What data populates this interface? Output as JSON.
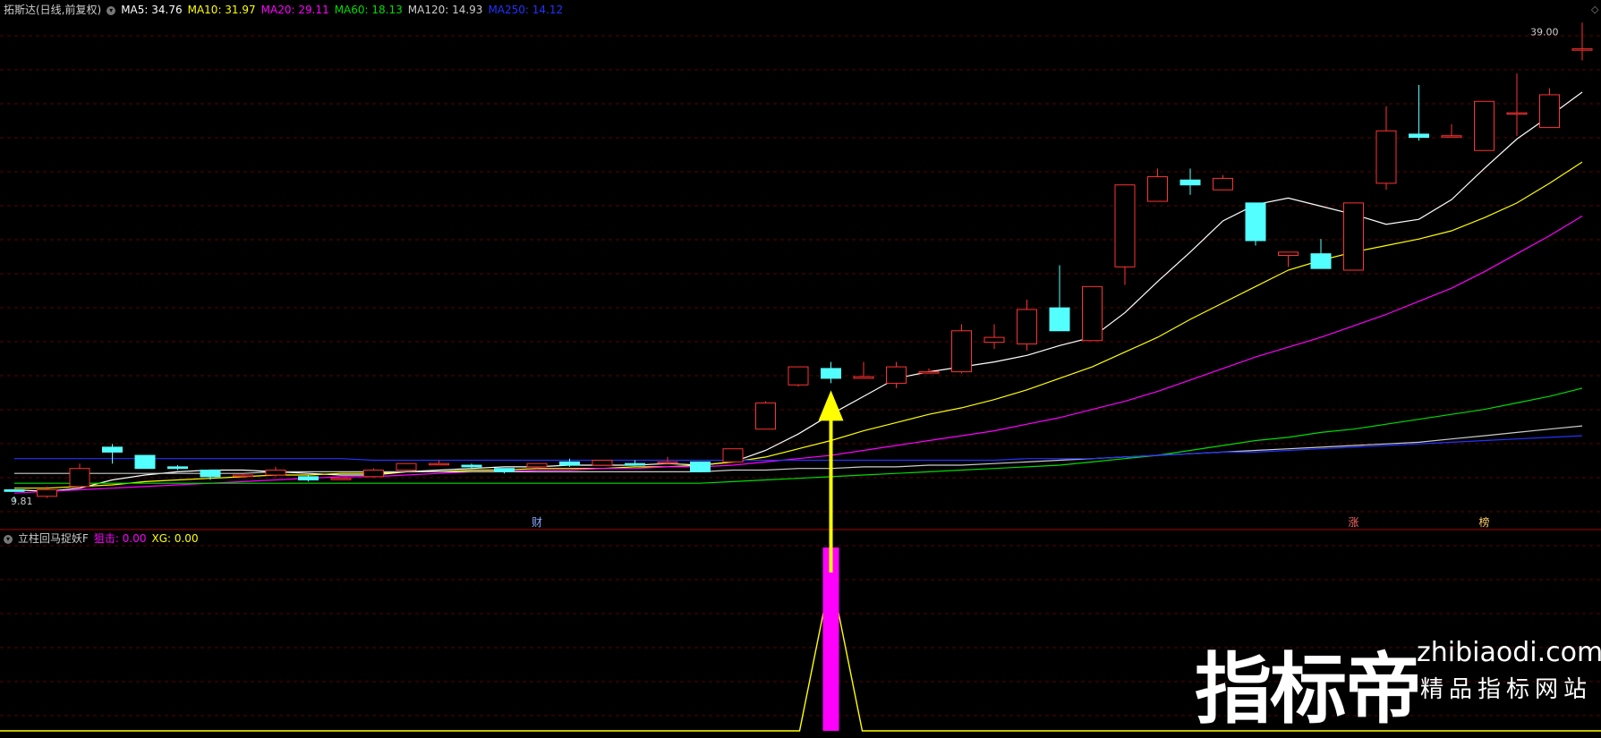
{
  "header": {
    "stock": "拓斯达(日线,前复权)",
    "ma": [
      {
        "label": "MA5: 34.76",
        "color": "#ffffff"
      },
      {
        "label": "MA10: 31.97",
        "color": "#ffff00"
      },
      {
        "label": "MA20: 29.11",
        "color": "#ff00ff"
      },
      {
        "label": "MA60: 18.13",
        "color": "#00dd00"
      },
      {
        "label": "MA120: 14.93",
        "color": "#cccccc"
      },
      {
        "label": "MA250: 14.12",
        "color": "#2233ff"
      }
    ]
  },
  "indicator": {
    "title": "立柱回马捉妖F",
    "values": [
      {
        "label": "狙击: 0.00",
        "color": "#ff00ff"
      },
      {
        "label": "XG: 0.00",
        "color": "#ffff00"
      }
    ]
  },
  "chart_data": {
    "type": "candlestick",
    "price_range": [
      9.0,
      39.4
    ],
    "high_label": "39.00",
    "low_label": "9.81",
    "candles": [
      [
        10.5,
        10.4,
        9.81,
        10.1
      ],
      [
        10.1,
        10.5,
        10.0,
        10.7
      ],
      [
        10.7,
        11.8,
        10.7,
        12.1
      ],
      [
        13.1,
        12.8,
        12.1,
        13.3
      ],
      [
        12.6,
        11.8,
        11.8,
        12.6
      ],
      [
        11.9,
        11.8,
        11.7,
        12.0
      ],
      [
        11.7,
        11.3,
        11.1,
        11.7
      ],
      [
        11.4,
        11.4,
        11.3,
        11.5
      ],
      [
        11.4,
        11.7,
        11.3,
        11.9
      ],
      [
        11.3,
        11.1,
        11.0,
        11.4
      ],
      [
        11.2,
        11.2,
        11.1,
        11.2
      ],
      [
        11.3,
        11.7,
        11.3,
        11.8
      ],
      [
        11.7,
        12.1,
        11.7,
        12.1
      ],
      [
        12.1,
        12.1,
        12.1,
        12.3
      ],
      [
        12.0,
        11.9,
        11.8,
        12.1
      ],
      [
        11.8,
        11.6,
        11.5,
        11.8
      ],
      [
        11.9,
        12.1,
        11.8,
        12.1
      ],
      [
        12.2,
        12.0,
        11.9,
        12.4
      ],
      [
        12.0,
        12.3,
        12.0,
        12.3
      ],
      [
        12.1,
        12.0,
        12.0,
        12.3
      ],
      [
        12.2,
        12.2,
        12.1,
        12.5
      ],
      [
        12.2,
        11.6,
        11.6,
        12.1
      ],
      [
        12.2,
        13.0,
        12.2,
        13.0
      ],
      [
        14.2,
        15.8,
        14.2,
        15.9
      ],
      [
        16.9,
        18.0,
        16.8,
        18.0
      ],
      [
        17.9,
        17.3,
        17.0,
        18.3
      ],
      [
        17.3,
        17.4,
        17.3,
        18.3
      ],
      [
        17.0,
        18.0,
        16.7,
        18.3
      ],
      [
        17.7,
        17.7,
        17.6,
        17.9
      ],
      [
        17.7,
        20.2,
        17.6,
        20.6
      ],
      [
        19.5,
        19.8,
        19.1,
        20.6
      ],
      [
        19.4,
        21.5,
        19.0,
        22.1
      ],
      [
        21.6,
        20.2,
        20.3,
        24.2
      ],
      [
        19.6,
        22.9,
        19.6,
        22.9
      ],
      [
        24.1,
        29.1,
        23.0,
        29.1
      ],
      [
        28.1,
        29.6,
        28.5,
        30.1
      ],
      [
        29.4,
        29.1,
        28.5,
        30.1
      ],
      [
        28.8,
        29.5,
        28.8,
        29.7
      ],
      [
        28.0,
        25.7,
        25.4,
        28.0
      ],
      [
        24.8,
        25.0,
        24.1,
        25.0
      ],
      [
        24.9,
        24.0,
        24.0,
        25.8
      ],
      [
        23.9,
        28.0,
        23.9,
        28.0
      ],
      [
        29.2,
        32.4,
        28.8,
        33.9
      ],
      [
        32.2,
        32.0,
        31.8,
        35.2
      ],
      [
        32.1,
        32.1,
        32.0,
        32.8
      ],
      [
        31.2,
        34.2,
        31.2,
        34.2
      ],
      [
        33.5,
        33.5,
        32.1,
        35.9
      ],
      [
        32.6,
        34.6,
        32.6,
        35.0
      ],
      [
        37.4,
        37.4,
        36.7,
        39.0
      ]
    ],
    "series": [
      {
        "name": "MA5",
        "color": "#ffffff",
        "values": [
          10.5,
          10.4,
          10.6,
          11.1,
          11.4,
          11.6,
          11.7,
          11.7,
          11.6,
          11.5,
          11.4,
          11.4,
          11.6,
          11.7,
          11.8,
          11.9,
          11.9,
          12.0,
          12.0,
          12.0,
          12.1,
          12.0,
          12.2,
          12.9,
          13.9,
          15.1,
          16.2,
          17.3,
          17.7,
          18.0,
          18.3,
          18.7,
          19.3,
          19.8,
          21.3,
          23.2,
          25.0,
          26.9,
          27.9,
          28.3,
          27.8,
          27.3,
          26.7,
          27.0,
          28.2,
          30.1,
          31.9,
          33.3,
          34.76
        ]
      },
      {
        "name": "MA10",
        "color": "#ffff00",
        "values": [
          10.6,
          10.6,
          10.7,
          10.8,
          11.0,
          11.1,
          11.2,
          11.3,
          11.4,
          11.4,
          11.5,
          11.5,
          11.6,
          11.6,
          11.7,
          11.7,
          11.8,
          11.8,
          11.8,
          11.9,
          11.9,
          12.0,
          12.2,
          12.5,
          13.0,
          13.5,
          14.1,
          14.6,
          15.1,
          15.5,
          16.0,
          16.6,
          17.3,
          18.0,
          18.9,
          19.8,
          20.9,
          21.9,
          22.9,
          23.9,
          24.5,
          25.0,
          25.4,
          25.8,
          26.3,
          27.1,
          28.0,
          29.2,
          30.5
        ]
      },
      {
        "name": "MA20",
        "color": "#ff00ff",
        "values": [
          10.3,
          10.4,
          10.5,
          10.6,
          10.7,
          10.8,
          10.9,
          11.0,
          11.1,
          11.2,
          11.3,
          11.3,
          11.4,
          11.5,
          11.6,
          11.6,
          11.7,
          11.7,
          11.8,
          11.8,
          11.9,
          11.9,
          12.0,
          12.2,
          12.4,
          12.6,
          12.9,
          13.2,
          13.5,
          13.8,
          14.1,
          14.5,
          14.9,
          15.4,
          15.9,
          16.5,
          17.2,
          17.9,
          18.6,
          19.2,
          19.8,
          20.5,
          21.2,
          22.0,
          22.8,
          23.8,
          24.9,
          26.0,
          27.2
        ]
      },
      {
        "name": "MA60",
        "color": "#00dd00",
        "values": [
          10.9,
          10.9,
          10.9,
          10.9,
          10.9,
          10.9,
          10.9,
          10.9,
          10.9,
          10.9,
          10.9,
          10.9,
          10.9,
          10.9,
          10.9,
          10.9,
          10.9,
          10.9,
          10.9,
          10.9,
          10.9,
          10.9,
          11.0,
          11.1,
          11.2,
          11.3,
          11.4,
          11.5,
          11.6,
          11.7,
          11.8,
          11.9,
          12.0,
          12.2,
          12.4,
          12.6,
          12.9,
          13.2,
          13.5,
          13.7,
          14.0,
          14.2,
          14.5,
          14.8,
          15.1,
          15.4,
          15.8,
          16.2,
          16.7
        ]
      },
      {
        "name": "MA120",
        "color": "#cccccc",
        "values": [
          11.5,
          11.5,
          11.5,
          11.5,
          11.5,
          11.5,
          11.5,
          11.5,
          11.6,
          11.6,
          11.6,
          11.6,
          11.6,
          11.6,
          11.6,
          11.6,
          11.6,
          11.6,
          11.6,
          11.6,
          11.6,
          11.6,
          11.7,
          11.7,
          11.8,
          11.8,
          11.9,
          11.9,
          12.0,
          12.0,
          12.1,
          12.2,
          12.3,
          12.4,
          12.5,
          12.6,
          12.7,
          12.8,
          12.9,
          13.0,
          13.1,
          13.2,
          13.3,
          13.4,
          13.6,
          13.8,
          14.0,
          14.2,
          14.4
        ]
      },
      {
        "name": "MA250",
        "color": "#2233ff",
        "values": [
          12.4,
          12.4,
          12.4,
          12.4,
          12.4,
          12.4,
          12.4,
          12.4,
          12.4,
          12.4,
          12.4,
          12.3,
          12.3,
          12.3,
          12.3,
          12.3,
          12.3,
          12.3,
          12.3,
          12.3,
          12.3,
          12.3,
          12.3,
          12.3,
          12.3,
          12.3,
          12.3,
          12.3,
          12.3,
          12.3,
          12.3,
          12.4,
          12.4,
          12.4,
          12.5,
          12.6,
          12.7,
          12.8,
          12.8,
          12.9,
          13.0,
          13.1,
          13.2,
          13.3,
          13.4,
          13.5,
          13.6,
          13.7,
          13.8
        ]
      }
    ],
    "markers": [
      {
        "candle": 16,
        "text": "财",
        "color": "#88aaff"
      },
      {
        "candle": 41,
        "text": "涨",
        "color": "#ff6666"
      },
      {
        "candle": 45,
        "text": "榜",
        "color": "#ffcc66"
      }
    ],
    "indicator_signal": {
      "candle": 25,
      "bar_value": 1.0,
      "peak_value": 0.85,
      "color": "#ff00ff",
      "line_color": "#ffff00"
    }
  },
  "watermark": {
    "big": "指标帝",
    "url": "zhibiaodi.com",
    "sub": "精品指标网站"
  }
}
